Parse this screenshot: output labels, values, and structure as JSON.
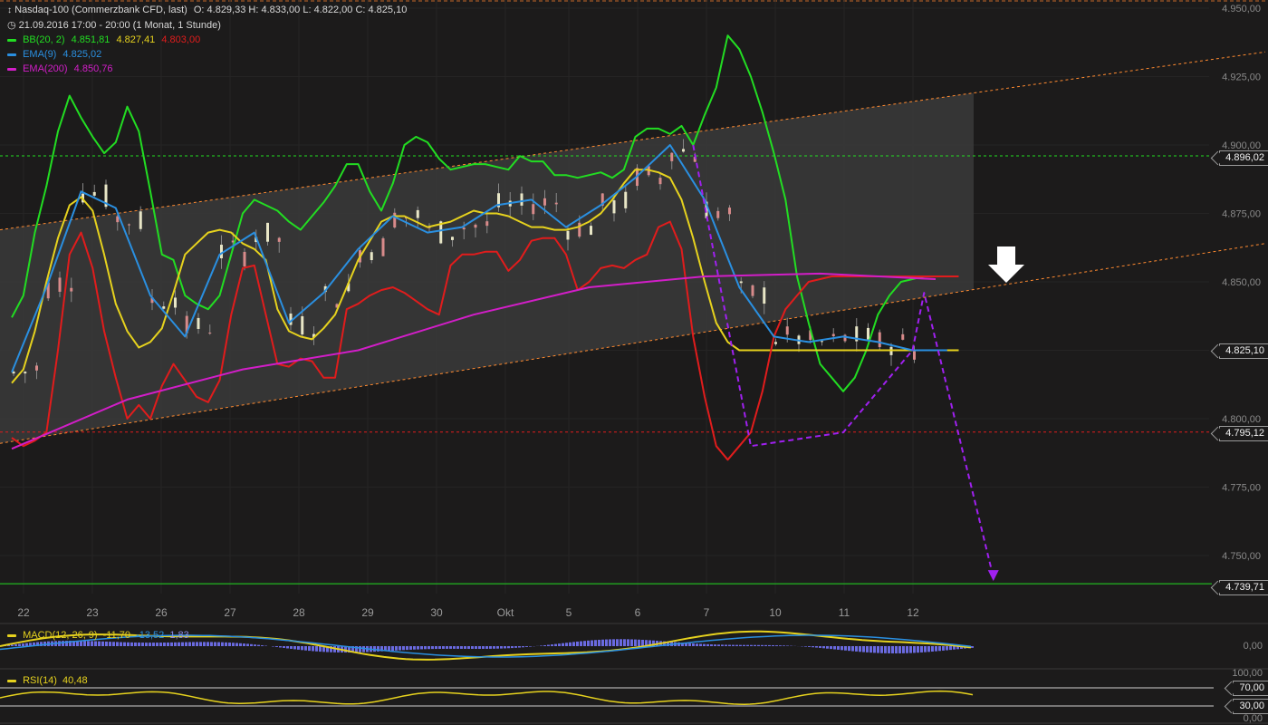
{
  "header": {
    "symbol": "Nasdaq-100 (Commerzbank CFD, last)",
    "ohlc": "O: 4.829,33  H: 4.833,00  L: 4.822,00  C: 4.825,10",
    "period": "21.09.2016 17:00 - 20:00 (1 Monat, 1 Stunde)",
    "bb_label": "BB(20, 2)",
    "bb_mid": "4.851,81",
    "bb_upper": "4.827,41",
    "bb_lower": "4.803,00",
    "ema9_label": "EMA(9)",
    "ema9_value": "4.825,02",
    "ema200_label": "EMA(200)",
    "ema200_value": "4.850,76"
  },
  "price_tags": {
    "resistance": "4.896,02",
    "last": "4.825,10",
    "support": "4.795,12",
    "target": "4.739,71"
  },
  "macd_panel": {
    "label": "MACD(12, 26, 9)",
    "v1": "-11,70",
    "v2": "-13,52",
    "v3": "1,83",
    "zero_tick": "0,00"
  },
  "rsi_panel": {
    "label": "RSI(14)",
    "value": "40,48",
    "tick_100": "100,00",
    "tick_70": "70,00",
    "tick_30": "30,00",
    "tick_0": "0,00"
  },
  "colors": {
    "background": "#1c1b1b",
    "bb_upper": "#22dd22",
    "bb_middle": "#e6d21e",
    "bb_lower": "#e11c1c",
    "ema9": "#2a8fe0",
    "ema200": "#d21ec8",
    "channel": "#ff8a30",
    "projection": "#a020f0",
    "candle_up": "#e8e6c6",
    "candle_down": "#d88a8a"
  },
  "chart_data": {
    "type": "line",
    "y_ticks": [
      "4.950,00",
      "4.925,00",
      "4.900,00",
      "4.875,00",
      "4.850,00",
      "4.825,00",
      "4.800,00",
      "4.775,00",
      "4.750,00"
    ],
    "x_ticks": [
      "22",
      "23",
      "26",
      "27",
      "28",
      "29",
      "30",
      "Okt",
      "5",
      "6",
      "7",
      "10",
      "11",
      "12"
    ],
    "ylim": [
      4736,
      4952
    ],
    "horizontal_levels": [
      {
        "value": 4896.02,
        "style": "dashed",
        "color": "#22dd22"
      },
      {
        "value": 4795.12,
        "style": "dashed",
        "color": "#e11c1c"
      },
      {
        "value": 4739.71,
        "style": "solid",
        "color": "#22dd22"
      }
    ],
    "trend_channel": {
      "upper": {
        "start": [
          0,
          4869
        ],
        "end": [
          96,
          4934
        ]
      },
      "lower": {
        "start": [
          0,
          4791
        ],
        "end": [
          96,
          4864
        ]
      }
    },
    "series": [
      {
        "name": "BB(20, 2)",
        "color": "#22dd22",
        "x": [
          0,
          1,
          2,
          3,
          4,
          5,
          6,
          7,
          8,
          9,
          10,
          11,
          12,
          13,
          14,
          15,
          16,
          17,
          18,
          19,
          20,
          21,
          22,
          23,
          24,
          25,
          26,
          27,
          28,
          29,
          30,
          31,
          32,
          33,
          34,
          35,
          36,
          37,
          38,
          39,
          40,
          41,
          42,
          43,
          44,
          45,
          46,
          47,
          48,
          49,
          50,
          51,
          52,
          53,
          54,
          55,
          56,
          57,
          58,
          59,
          60,
          61,
          62,
          63,
          64,
          65,
          66,
          67,
          68,
          69,
          70,
          71,
          72,
          73,
          74,
          75,
          76,
          77,
          78,
          79,
          80,
          81,
          82
        ],
        "values": [
          4837,
          4845,
          4868,
          4885,
          4905,
          4918,
          4910,
          4903,
          4897,
          4901,
          4914,
          4905,
          4883,
          4860,
          4858,
          4845,
          4842,
          4840,
          4845,
          4860,
          4875,
          4880,
          4878,
          4876,
          4872,
          4869,
          4874,
          4879,
          4885,
          4893,
          4893,
          4883,
          4876,
          4886,
          4900,
          4903,
          4901,
          4895,
          4891,
          4892,
          4893,
          4893,
          4892,
          4891,
          4896,
          4894,
          4894,
          4889,
          4889,
          4888,
          4889,
          4890,
          4888,
          4891,
          4903,
          4906,
          4906,
          4904,
          4907,
          4900,
          4911,
          4921,
          4940,
          4935,
          4925,
          4912,
          4897,
          4880,
          4852,
          4835,
          4820,
          4815,
          4810,
          4815,
          4825,
          4838,
          4845,
          4850,
          4851,
          4852,
          4852,
          4852,
          4852
        ]
      },
      {
        "name": "BB middle",
        "color": "#e6d21e",
        "x": [
          0,
          1,
          2,
          3,
          4,
          5,
          6,
          7,
          8,
          9,
          10,
          11,
          12,
          13,
          14,
          15,
          16,
          17,
          18,
          19,
          20,
          21,
          22,
          23,
          24,
          25,
          26,
          27,
          28,
          29,
          30,
          31,
          32,
          33,
          34,
          35,
          36,
          37,
          38,
          39,
          40,
          41,
          42,
          43,
          44,
          45,
          46,
          47,
          48,
          49,
          50,
          51,
          52,
          53,
          54,
          55,
          56,
          57,
          58,
          59,
          60,
          61,
          62,
          63,
          64,
          65,
          66,
          67,
          68,
          69,
          70,
          71,
          72,
          73,
          74,
          75,
          76,
          77,
          78,
          79,
          80,
          81,
          82
        ],
        "values": [
          4813,
          4818,
          4832,
          4850,
          4866,
          4878,
          4881,
          4876,
          4860,
          4842,
          4832,
          4826,
          4828,
          4833,
          4846,
          4860,
          4864,
          4868,
          4869,
          4868,
          4864,
          4862,
          4858,
          4840,
          4832,
          4830,
          4829,
          4833,
          4838,
          4848,
          4858,
          4865,
          4872,
          4874,
          4874,
          4872,
          4870,
          4871,
          4872,
          4874,
          4876,
          4875,
          4875,
          4874,
          4872,
          4870,
          4870,
          4869,
          4869,
          4870,
          4872,
          4875,
          4880,
          4886,
          4891,
          4891,
          4890,
          4888,
          4880,
          4866,
          4850,
          4835,
          4828,
          4825,
          4825,
          4825,
          4825,
          4825,
          4825,
          4825,
          4825,
          4825,
          4825,
          4825,
          4825,
          4825,
          4825,
          4825,
          4825,
          4825,
          4825,
          4825,
          4825
        ]
      },
      {
        "name": "BB lower",
        "color": "#e11c1c",
        "x": [
          0,
          1,
          2,
          3,
          4,
          5,
          6,
          7,
          8,
          9,
          10,
          11,
          12,
          13,
          14,
          15,
          16,
          17,
          18,
          19,
          20,
          21,
          22,
          23,
          24,
          25,
          26,
          27,
          28,
          29,
          30,
          31,
          32,
          33,
          34,
          35,
          36,
          37,
          38,
          39,
          40,
          41,
          42,
          43,
          44,
          45,
          46,
          47,
          48,
          49,
          50,
          51,
          52,
          53,
          54,
          55,
          56,
          57,
          58,
          59,
          60,
          61,
          62,
          63,
          64,
          65,
          66,
          67,
          68,
          69,
          70,
          71,
          72,
          73,
          74,
          75,
          76,
          77,
          78,
          79,
          80,
          81,
          82
        ],
        "values": [
          4793,
          4790,
          4792,
          4795,
          4825,
          4860,
          4868,
          4855,
          4832,
          4815,
          4800,
          4805,
          4800,
          4812,
          4820,
          4814,
          4808,
          4806,
          4814,
          4838,
          4855,
          4856,
          4838,
          4820,
          4819,
          4822,
          4821,
          4815,
          4815,
          4840,
          4842,
          4845,
          4847,
          4848,
          4846,
          4843,
          4840,
          4838,
          4856,
          4860,
          4860,
          4861,
          4861,
          4854,
          4858,
          4865,
          4866,
          4866,
          4860,
          4847,
          4850,
          4855,
          4856,
          4855,
          4858,
          4860,
          4870,
          4872,
          4862,
          4830,
          4808,
          4790,
          4785,
          4790,
          4795,
          4810,
          4830,
          4840,
          4845,
          4850,
          4851,
          4852,
          4852,
          4852,
          4852,
          4852,
          4852,
          4852,
          4852,
          4852,
          4852,
          4852,
          4852
        ]
      },
      {
        "name": "EMA(9)",
        "color": "#2a8fe0",
        "x": [
          0,
          3,
          6,
          9,
          12,
          15,
          18,
          21,
          24,
          27,
          30,
          33,
          36,
          39,
          42,
          45,
          48,
          51,
          54,
          57,
          60,
          63,
          66,
          69,
          72,
          75,
          78,
          81
        ],
        "values": [
          4817,
          4848,
          4883,
          4877,
          4845,
          4830,
          4860,
          4868,
          4835,
          4846,
          4862,
          4874,
          4868,
          4870,
          4878,
          4880,
          4870,
          4878,
          4888,
          4900,
          4880,
          4848,
          4830,
          4828,
          4830,
          4828,
          4825,
          4825
        ]
      },
      {
        "name": "EMA(200)",
        "color": "#d21ec8",
        "x": [
          0,
          10,
          20,
          30,
          40,
          50,
          60,
          70,
          80
        ],
        "values": [
          4789,
          4807,
          4818,
          4825,
          4838,
          4848,
          4852,
          4853,
          4851
        ]
      }
    ],
    "projection": {
      "color": "#a020f0",
      "x": [
        59,
        64,
        72,
        78,
        79,
        85
      ],
      "values": [
        4900,
        4790,
        4795,
        4825,
        4846,
        4742
      ],
      "style": "dashed-arrow"
    }
  }
}
